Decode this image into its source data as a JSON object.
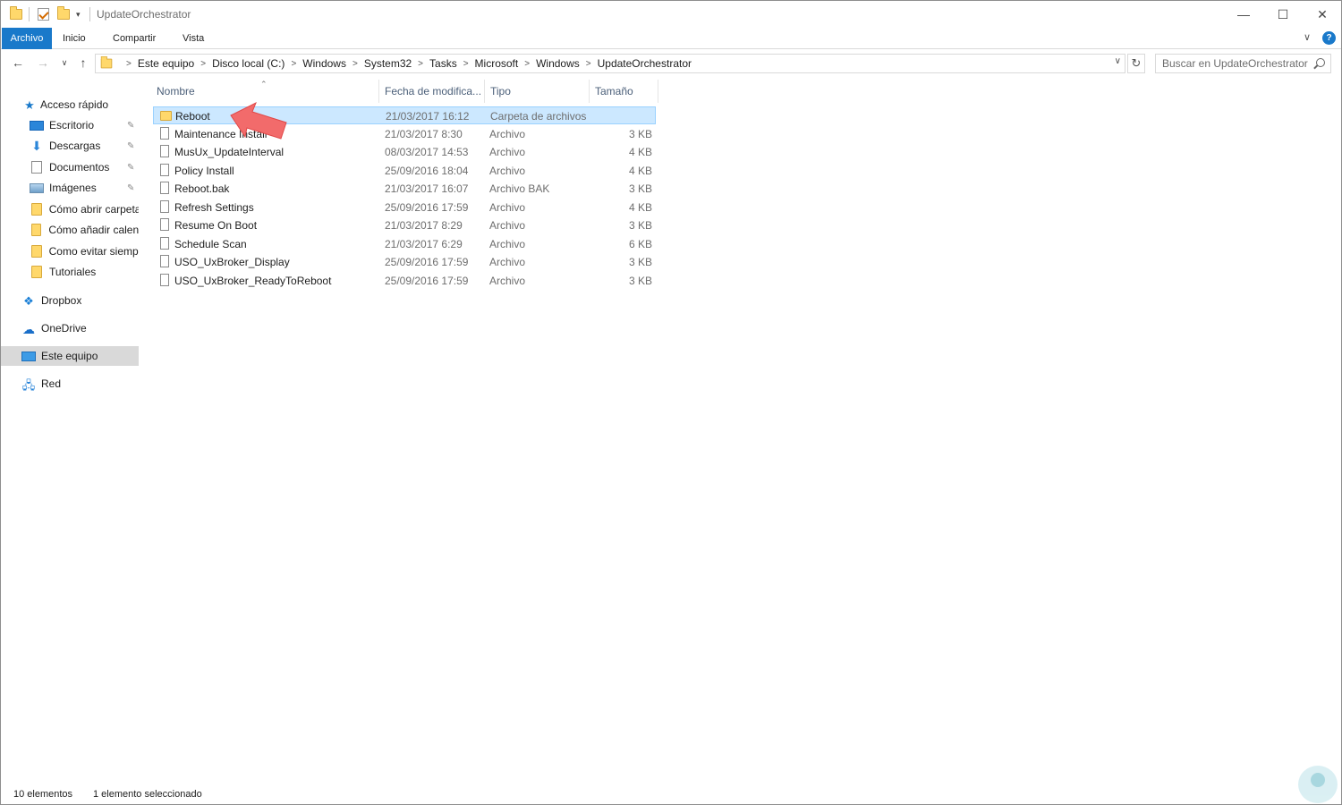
{
  "window": {
    "title": "UpdateOrchestrator"
  },
  "titlebar": {
    "minimize": "—",
    "maximize": "☐",
    "close": "✕"
  },
  "ribbon": {
    "tabs": [
      "Archivo",
      "Inicio",
      "Compartir",
      "Vista"
    ],
    "help": "?"
  },
  "address": {
    "crumbs": [
      "Este equipo",
      "Disco local (C:)",
      "Windows",
      "System32",
      "Tasks",
      "Microsoft",
      "Windows",
      "UpdateOrchestrator"
    ]
  },
  "search": {
    "placeholder": "Buscar en UpdateOrchestrator"
  },
  "nav": {
    "quick_access": "Acceso rápido",
    "items": [
      {
        "label": "Escritorio",
        "icon": "desktop-icon",
        "pinned": true
      },
      {
        "label": "Descargas",
        "icon": "download-icon",
        "pinned": true
      },
      {
        "label": "Documentos",
        "icon": "documents-icon",
        "pinned": true
      },
      {
        "label": "Imágenes",
        "icon": "pictures-icon",
        "pinned": true
      },
      {
        "label": "Cómo abrir carpeta",
        "icon": "folder-icon",
        "pinned": false
      },
      {
        "label": "Cómo añadir calenc",
        "icon": "folder-icon",
        "pinned": false
      },
      {
        "label": "Como evitar siempr",
        "icon": "folder-icon",
        "pinned": false
      },
      {
        "label": "Tutoriales",
        "icon": "folder-icon",
        "pinned": false
      }
    ],
    "dropbox": "Dropbox",
    "onedrive": "OneDrive",
    "this_pc": "Este equipo",
    "network": "Red"
  },
  "columns": {
    "name": "Nombre",
    "date": "Fecha de modifica...",
    "type": "Tipo",
    "size": "Tamaño"
  },
  "files": [
    {
      "name": "Reboot",
      "date": "21/03/2017 16:12",
      "type": "Carpeta de archivos",
      "size": "",
      "is_folder": true,
      "selected": true
    },
    {
      "name": "Maintenance Install",
      "date": "21/03/2017 8:30",
      "type": "Archivo",
      "size": "3 KB"
    },
    {
      "name": "MusUx_UpdateInterval",
      "date": "08/03/2017 14:53",
      "type": "Archivo",
      "size": "4 KB"
    },
    {
      "name": "Policy Install",
      "date": "25/09/2016 18:04",
      "type": "Archivo",
      "size": "4 KB"
    },
    {
      "name": "Reboot.bak",
      "date": "21/03/2017 16:07",
      "type": "Archivo BAK",
      "size": "3 KB"
    },
    {
      "name": "Refresh Settings",
      "date": "25/09/2016 17:59",
      "type": "Archivo",
      "size": "4 KB"
    },
    {
      "name": "Resume On Boot",
      "date": "21/03/2017 8:29",
      "type": "Archivo",
      "size": "3 KB"
    },
    {
      "name": "Schedule Scan",
      "date": "21/03/2017 6:29",
      "type": "Archivo",
      "size": "6 KB"
    },
    {
      "name": "USO_UxBroker_Display",
      "date": "25/09/2016 17:59",
      "type": "Archivo",
      "size": "3 KB"
    },
    {
      "name": "USO_UxBroker_ReadyToReboot",
      "date": "25/09/2016 17:59",
      "type": "Archivo",
      "size": "3 KB"
    }
  ],
  "status": {
    "count": "10 elementos",
    "selection": "1 elemento seleccionado"
  },
  "colors": {
    "accent": "#1979ca",
    "selection": "#cce8ff",
    "annotation_arrow": "#f26b6b"
  }
}
